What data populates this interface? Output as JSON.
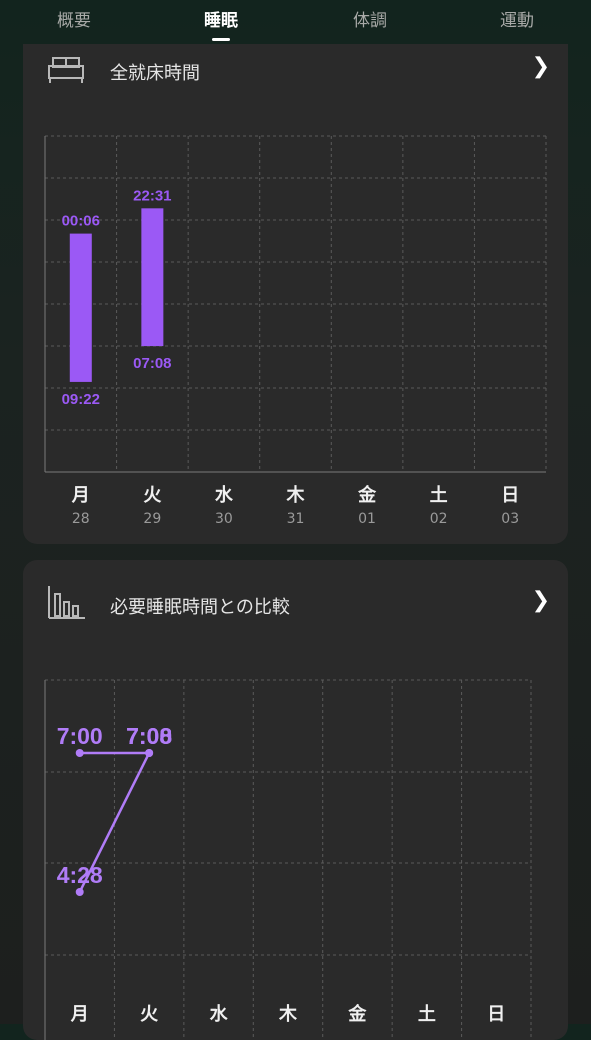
{
  "tabs": [
    {
      "label": "概要",
      "active": false
    },
    {
      "label": "睡眠",
      "active": true
    },
    {
      "label": "体調",
      "active": false
    },
    {
      "label": "運動",
      "active": false
    }
  ],
  "bed_card": {
    "title": "全就床時間",
    "icon": "bed-icon",
    "days": [
      {
        "name": "月",
        "date": "28"
      },
      {
        "name": "火",
        "date": "29"
      },
      {
        "name": "水",
        "date": "30"
      },
      {
        "name": "木",
        "date": "31"
      },
      {
        "name": "金",
        "date": "01"
      },
      {
        "name": "土",
        "date": "02"
      },
      {
        "name": "日",
        "date": "03"
      }
    ],
    "bars": [
      {
        "day": "月",
        "start": "00:06",
        "end": "09:22",
        "start_h": 24.1,
        "end_h": 33.37
      },
      {
        "day": "火",
        "start": "22:31",
        "end": "07:08",
        "start_h": 22.52,
        "end_h": 31.13
      }
    ],
    "range_h": [
      18,
      39
    ],
    "color": "#9b59f5"
  },
  "compare_card": {
    "title": "必要睡眠時間との比較",
    "icon": "bar-chart-icon",
    "days": [
      "月",
      "火",
      "水",
      "木",
      "金",
      "土",
      "日"
    ],
    "series": [
      {
        "values_h": [
          7.0,
          7.13
        ],
        "labels": [
          "7:00",
          "7:08"
        ]
      },
      {
        "values_h": [
          4.47,
          7.0
        ],
        "labels": [
          "4:28",
          "7:00"
        ]
      }
    ],
    "range_h": [
      2,
      10
    ],
    "color": "#b07cf7"
  }
}
